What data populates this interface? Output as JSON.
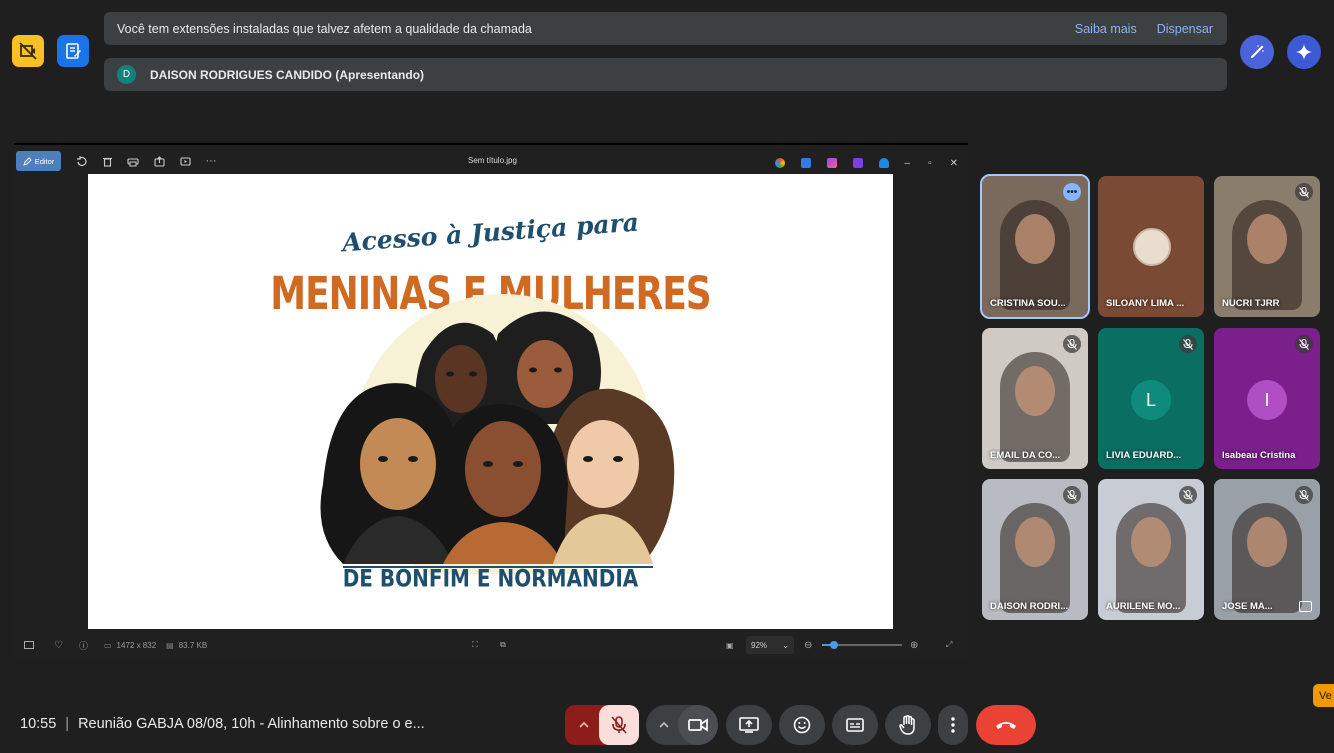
{
  "notification": {
    "message": "Você tem extensões instaladas que talvez afetem a qualidade da chamada",
    "learn_more": "Saiba mais",
    "dismiss": "Dispensar"
  },
  "presenter": {
    "initial": "D",
    "label": "DAISON RODRIGUES CANDIDO (Apresentando)"
  },
  "viewer": {
    "editor_label": "Editor",
    "file_name": "Sem título.jpg",
    "dimensions": "1472 x 832",
    "file_size": "83.7 KB",
    "zoom": "92%",
    "zoom_fraction": 0.15
  },
  "artwork": {
    "line1": "Acesso à Justiça para",
    "line2": "MENINAS E MULHERES",
    "line3": "DE BONFIM E NORMANDIA"
  },
  "participants": [
    {
      "name": "CRISTINA SOU...",
      "muted": false,
      "bg": "#7a6a5e"
    },
    {
      "name": "SILOANY LIMA ...",
      "muted": false,
      "bg": "#7a4a34"
    },
    {
      "name": "NUCRI TJRR",
      "muted": true,
      "bg": "#8a7d6c"
    },
    {
      "name": "EMAIL DA CO...",
      "muted": true,
      "bg": "#cfcac4"
    },
    {
      "name": "LIVIA EDUARD...",
      "muted": true,
      "bg": "#0b6e63",
      "initial": "L",
      "avatar_color": "#0f8a7c"
    },
    {
      "name": "Isabeau Cristina",
      "muted": true,
      "bg": "#7a1f8c",
      "initial": "I",
      "avatar_color": "#b04fc4"
    },
    {
      "name": "DAISON RODRI...",
      "muted": true,
      "bg": "#b8bcc2"
    },
    {
      "name": "AURILENE MO...",
      "muted": true,
      "bg": "#c8ccd4"
    },
    {
      "name": "JOSE MA...",
      "muted": true,
      "bg": "#9aa0a8"
    }
  ],
  "meeting": {
    "time": "10:55",
    "separator": "|",
    "title": "Reunião GABJA 08/08, 10h - Alinhamento sobre o e..."
  },
  "tag": "Ve",
  "colors": {
    "background": "#1f1f1f",
    "banner": "#3c4043",
    "link": "#8ab4f8",
    "hangup": "#ea4335",
    "mic_off": "#f9dedc"
  }
}
